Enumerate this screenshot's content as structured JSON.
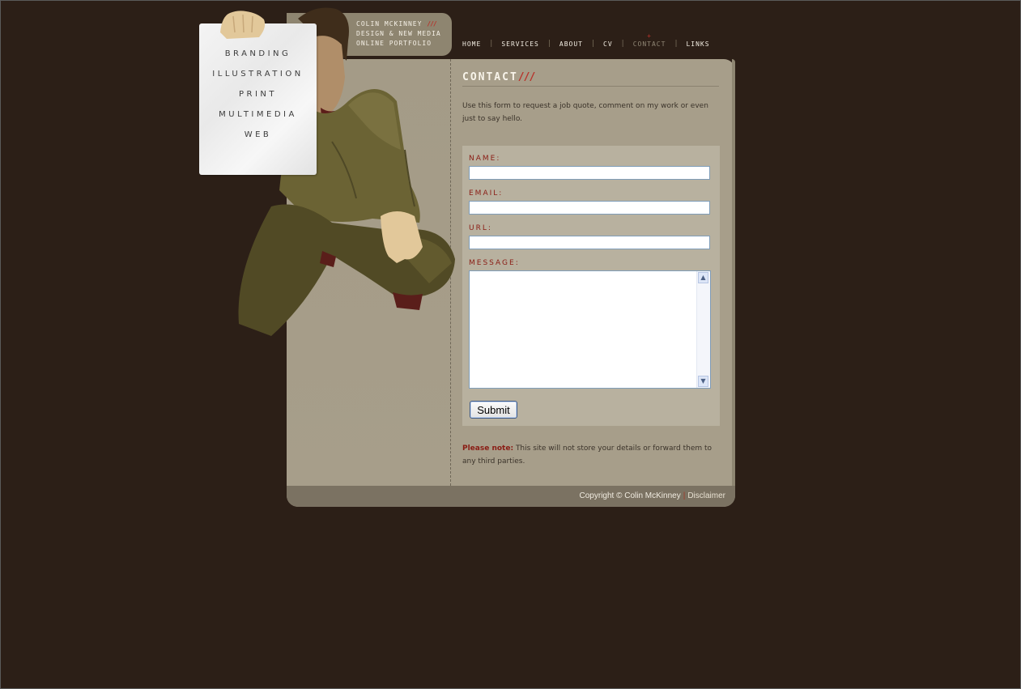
{
  "brand": {
    "line1": "COLIN MCKINNEY",
    "line1_slashes": "///",
    "line2": "DESIGN & NEW MEDIA",
    "line3": "ONLINE PORTFOLIO"
  },
  "nav": {
    "items": [
      {
        "label": "HOME"
      },
      {
        "label": "SERVICES"
      },
      {
        "label": "ABOUT"
      },
      {
        "label": "CV"
      },
      {
        "label": "CONTACT",
        "active": true
      },
      {
        "label": "LINKS"
      }
    ],
    "separator": "|"
  },
  "paper_menu": {
    "items": [
      {
        "label": "BRANDING"
      },
      {
        "label": "ILLUSTRATION"
      },
      {
        "label": "PRINT"
      },
      {
        "label": "MULTIMEDIA"
      },
      {
        "label": "WEB"
      }
    ]
  },
  "content": {
    "title": "CONTACT",
    "title_slashes": "///",
    "intro": "Use this form to request a job quote, comment on my work or even just to say hello."
  },
  "form": {
    "name_label": "NAME:",
    "name_value": "",
    "email_label": "EMAIL:",
    "email_value": "",
    "url_label": "URL:",
    "url_value": "",
    "message_label": "MESSAGE:",
    "message_value": "",
    "submit_label": "Submit"
  },
  "note": {
    "prefix": "Please note:",
    "text": "This site will not store your details or forward them to any third parties."
  },
  "footer": {
    "copyright": "Copyright © Colin McKinney",
    "separator": "|",
    "disclaimer": "Disclaimer"
  },
  "colors": {
    "page_bg": "#2c1f17",
    "card_bg": "#a79e8a",
    "accent_red": "#8a1c14",
    "slash_red": "#b8322a",
    "form_bg": "#b8b19f",
    "footer_bg": "#7b7262"
  }
}
